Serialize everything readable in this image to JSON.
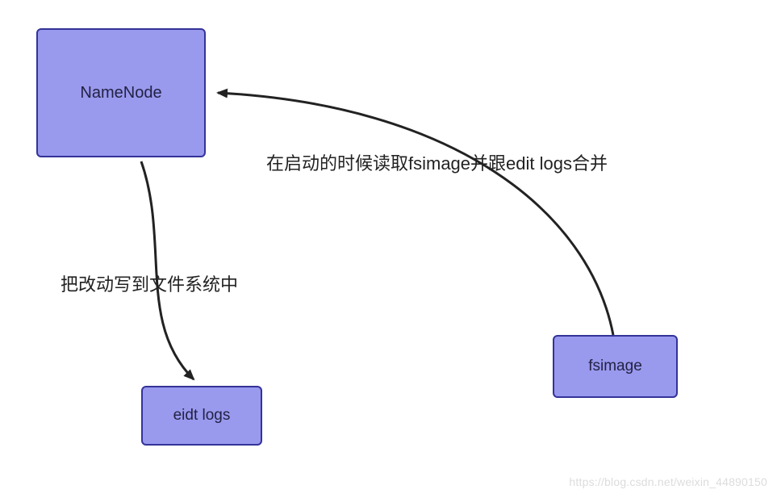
{
  "nodes": {
    "namenode": {
      "label": "NameNode"
    },
    "eidtlogs": {
      "label": "eidt logs"
    },
    "fsimage": {
      "label": "fsimage"
    }
  },
  "edges": {
    "readMerge": {
      "label": "在启动的时候读取fsimage并跟edit logs合并"
    },
    "writeFs": {
      "label": "把改动写到文件系统中"
    }
  },
  "watermark": "https://blog.csdn.net/weixin_44890150",
  "chart_data": {
    "type": "diagram",
    "nodes": [
      {
        "id": "NameNode",
        "label": "NameNode"
      },
      {
        "id": "eidt logs",
        "label": "eidt logs"
      },
      {
        "id": "fsimage",
        "label": "fsimage"
      }
    ],
    "edges": [
      {
        "from": "fsimage",
        "to": "NameNode",
        "label": "在启动的时候读取fsimage并跟edit logs合并"
      },
      {
        "from": "NameNode",
        "to": "eidt logs",
        "label": "把改动写到文件系统中"
      }
    ]
  }
}
